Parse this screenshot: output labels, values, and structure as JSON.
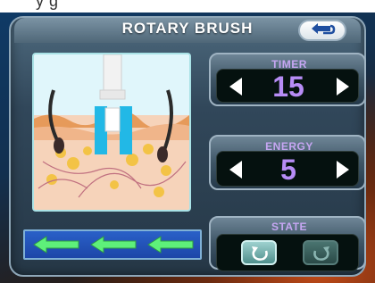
{
  "top_banner_text": "y                                                   g",
  "header": {
    "title": "ROTARY BRUSH"
  },
  "illustration": {
    "name": "rotary-brush-skin-illustration"
  },
  "timer": {
    "label": "TIMER",
    "value": "15"
  },
  "energy": {
    "label": "ENERGY",
    "value": "5"
  },
  "state": {
    "label": "STATE"
  },
  "colors": {
    "accent_purple": "#b78cf6",
    "label_purple": "#c6a6f2",
    "arrow_green": "#5ef07a",
    "strip_blue": "#1d46a8"
  }
}
